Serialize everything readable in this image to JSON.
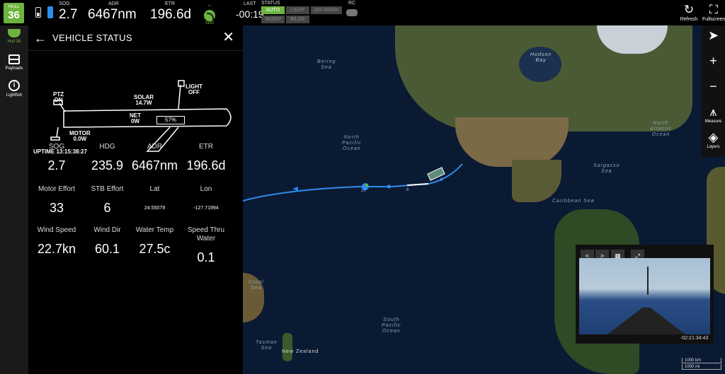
{
  "topbar": {
    "hull_top": "HULL",
    "hull_num": "36",
    "sog_label": "SOG",
    "sog_value": "2.7",
    "adr_label": "ADR",
    "adr_value": "6467nm",
    "etr_label": "ETR",
    "etr_value": "196.6d",
    "comm_dash": "--",
    "comm_label": "SBD",
    "last_label": "LAST",
    "last_value": "-00:19",
    "status_label": "STATUS",
    "status_pills": [
      {
        "label": "AUTO",
        "active": true
      },
      {
        "label": "LIGHT",
        "active": false
      },
      {
        "label": "AIS WARN",
        "active": false
      },
      {
        "label": "SKEEP",
        "active": false
      },
      {
        "label": "BILGE",
        "active": false
      }
    ],
    "rc_label": "RC",
    "refresh_label": "Refresh",
    "fullscreen_label": "Fullscreen"
  },
  "leftnav": {
    "items": [
      {
        "label": "Hull 36",
        "icon": "boat-icon"
      },
      {
        "label": "Payloads",
        "icon": "payload-icon"
      },
      {
        "label": "Lightfish",
        "icon": "info-icon"
      }
    ]
  },
  "panel": {
    "title": "VEHICLE STATUS",
    "diagram": {
      "ptz_label": "PTZ",
      "ptz_value": "ON",
      "solar_label": "SOLAR",
      "solar_value": "14.7W",
      "light_label": "LIGHT",
      "light_value": "OFF",
      "net_label": "NET",
      "net_value": "0W",
      "battery_pct": "57%",
      "motor_label": "MOTOR",
      "motor_value": "0.0W",
      "uptime": "UPTIME 13:15:38:27"
    },
    "rows": [
      [
        {
          "label": "SOG",
          "value": "2.7"
        },
        {
          "label": "HDG",
          "value": "235.9"
        },
        {
          "label": "ADR",
          "value": "6467nm"
        },
        {
          "label": "ETR",
          "value": "196.6d"
        }
      ],
      [
        {
          "label": "Motor Effort",
          "value": "33"
        },
        {
          "label": "STB Effort",
          "value": "6"
        },
        {
          "label": "Lat",
          "value": "24.55079"
        },
        {
          "label": "Lon",
          "value": "-127.71994"
        }
      ],
      [
        {
          "label": "Wind Speed",
          "value": "22.7kn"
        },
        {
          "label": "Wind Dir",
          "value": "60.1"
        },
        {
          "label": "Water Temp",
          "value": "27.5c"
        },
        {
          "label": "Speed Thru Water",
          "value": "0.1"
        }
      ]
    ]
  },
  "map": {
    "labels": {
      "north_pacific": "North\nPacific\nOcean",
      "south_pacific": "South\nPacific\nOcean",
      "north_atlantic": "North\nAtlantic\nOcean",
      "hudson": "Hudson\nBay",
      "bering": "Bering\nSea",
      "sargasso": "Sargasso\nSea",
      "caribbean": "Caribbean Sea",
      "coral": "Coral\nSea",
      "tasman": "Tasman\nSea",
      "nz": "New Zealand"
    },
    "track_markers": [
      "6",
      "5",
      "20"
    ],
    "tools": [
      {
        "label": "",
        "icon": "locate-icon"
      },
      {
        "label": "",
        "icon": "zoom-in-icon"
      },
      {
        "label": "",
        "icon": "zoom-out-icon"
      },
      {
        "label": "Measure",
        "icon": "measure-icon"
      },
      {
        "label": "Layers",
        "icon": "layers-icon"
      }
    ],
    "scale_km": "1000 km",
    "scale_mi": "1000 mi"
  },
  "camera": {
    "prev_label": "<",
    "next_label": ">",
    "timestamp": "-02:21:34:43"
  }
}
